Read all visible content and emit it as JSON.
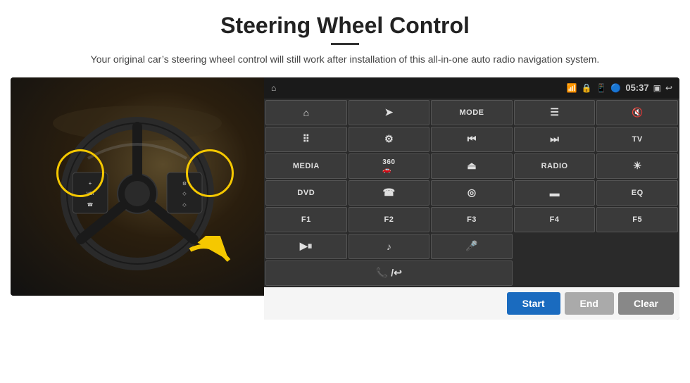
{
  "page": {
    "title": "Steering Wheel Control",
    "subtitle": "Your original car’s steering wheel control will still work after installation of this all-in-one auto radio navigation system.",
    "divider": true
  },
  "status_bar": {
    "time": "05:37",
    "icons": [
      "wifi",
      "lock",
      "sim",
      "bluetooth",
      "screen",
      "back"
    ]
  },
  "buttons": [
    {
      "id": "btn-home",
      "icon": "⌂",
      "label": "",
      "row": 1,
      "col": 1
    },
    {
      "id": "btn-nav",
      "icon": "➤",
      "label": "",
      "row": 1,
      "col": 2
    },
    {
      "id": "btn-mode",
      "icon": "",
      "label": "MODE",
      "row": 1,
      "col": 3
    },
    {
      "id": "btn-list",
      "icon": "☰",
      "label": "",
      "row": 1,
      "col": 4
    },
    {
      "id": "btn-mute",
      "icon": "🔇",
      "label": "",
      "row": 1,
      "col": 5
    },
    {
      "id": "btn-apps",
      "icon": "⋯",
      "label": "",
      "row": 1,
      "col": 6
    },
    {
      "id": "btn-settings",
      "icon": "⚙",
      "label": "",
      "row": 2,
      "col": 1
    },
    {
      "id": "btn-prev",
      "icon": "⏮",
      "label": "",
      "row": 2,
      "col": 2
    },
    {
      "id": "btn-next",
      "icon": "⏭",
      "label": "",
      "row": 2,
      "col": 3
    },
    {
      "id": "btn-tv",
      "icon": "",
      "label": "TV",
      "row": 2,
      "col": 4
    },
    {
      "id": "btn-media",
      "icon": "",
      "label": "MEDIA",
      "row": 2,
      "col": 5
    },
    {
      "id": "btn-360",
      "icon": "360",
      "label": "",
      "row": 3,
      "col": 1
    },
    {
      "id": "btn-eject",
      "icon": "⏏",
      "label": "",
      "row": 3,
      "col": 2
    },
    {
      "id": "btn-radio",
      "icon": "",
      "label": "RADIO",
      "row": 3,
      "col": 3
    },
    {
      "id": "btn-bright",
      "icon": "☀",
      "label": "",
      "row": 3,
      "col": 4
    },
    {
      "id": "btn-dvd",
      "icon": "",
      "label": "DVD",
      "row": 3,
      "col": 5
    },
    {
      "id": "btn-phone",
      "icon": "☎",
      "label": "",
      "row": 4,
      "col": 1
    },
    {
      "id": "btn-globe",
      "icon": "◎",
      "label": "",
      "row": 4,
      "col": 2
    },
    {
      "id": "btn-screen",
      "icon": "▬",
      "label": "",
      "row": 4,
      "col": 3
    },
    {
      "id": "btn-eq",
      "icon": "",
      "label": "EQ",
      "row": 4,
      "col": 4
    },
    {
      "id": "btn-f1",
      "icon": "",
      "label": "F1",
      "row": 4,
      "col": 5
    },
    {
      "id": "btn-f2",
      "icon": "",
      "label": "F2",
      "row": 5,
      "col": 1
    },
    {
      "id": "btn-f3",
      "icon": "",
      "label": "F3",
      "row": 5,
      "col": 2
    },
    {
      "id": "btn-f4",
      "icon": "",
      "label": "F4",
      "row": 5,
      "col": 3
    },
    {
      "id": "btn-f5",
      "icon": "",
      "label": "F5",
      "row": 5,
      "col": 4
    },
    {
      "id": "btn-playpause",
      "icon": "▶⏸",
      "label": "",
      "row": 5,
      "col": 5
    },
    {
      "id": "btn-music",
      "icon": "♪",
      "label": "",
      "row": 6,
      "col": 1
    },
    {
      "id": "btn-mic",
      "icon": "🎤",
      "label": "",
      "row": 6,
      "col": 2
    },
    {
      "id": "btn-handfree",
      "icon": "📞",
      "label": "",
      "row": 6,
      "col": 3
    }
  ],
  "action_bar": {
    "start_label": "Start",
    "end_label": "End",
    "clear_label": "Clear"
  }
}
